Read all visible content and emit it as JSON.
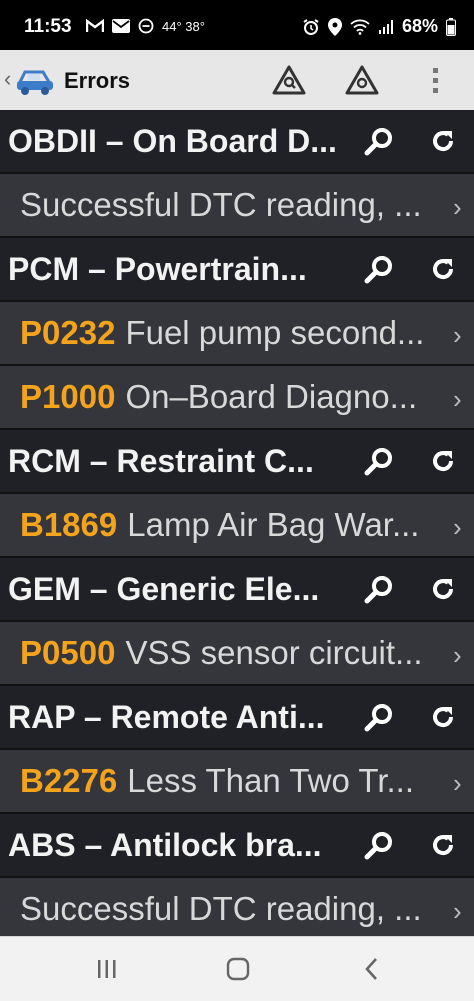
{
  "status_bar": {
    "time": "11:53",
    "temperature": "44° 38°",
    "battery": "68%"
  },
  "app_bar": {
    "title": "Errors",
    "icons": [
      "car-icon",
      "warning-search-icon",
      "warning-icon",
      "more-vertical-icon"
    ]
  },
  "rows": [
    {
      "type": "module",
      "text": "OBDII – On Board D..."
    },
    {
      "type": "detail",
      "code": "",
      "text": "Successful DTC reading, ..."
    },
    {
      "type": "module",
      "text": "PCM – Powertrain..."
    },
    {
      "type": "detail",
      "code": "P0232",
      "text": "Fuel pump second..."
    },
    {
      "type": "detail",
      "code": "P1000",
      "text": "On–Board Diagno..."
    },
    {
      "type": "module",
      "text": "RCM – Restraint C..."
    },
    {
      "type": "detail",
      "code": "B1869",
      "text": "Lamp Air Bag War..."
    },
    {
      "type": "module",
      "text": "GEM – Generic Ele..."
    },
    {
      "type": "detail",
      "code": "P0500",
      "text": "VSS sensor circuit..."
    },
    {
      "type": "module",
      "text": "RAP – Remote Anti..."
    },
    {
      "type": "detail",
      "code": "B2276",
      "text": "Less Than Two Tr..."
    },
    {
      "type": "module",
      "text": "ABS – Antilock bra..."
    },
    {
      "type": "detail",
      "code": "",
      "text": "Successful DTC reading, ..."
    }
  ],
  "colors": {
    "code": "#f3a31c",
    "module_bg": "#202127",
    "detail_bg": "#34363c",
    "app_bar_bg": "#e7e7e7"
  }
}
